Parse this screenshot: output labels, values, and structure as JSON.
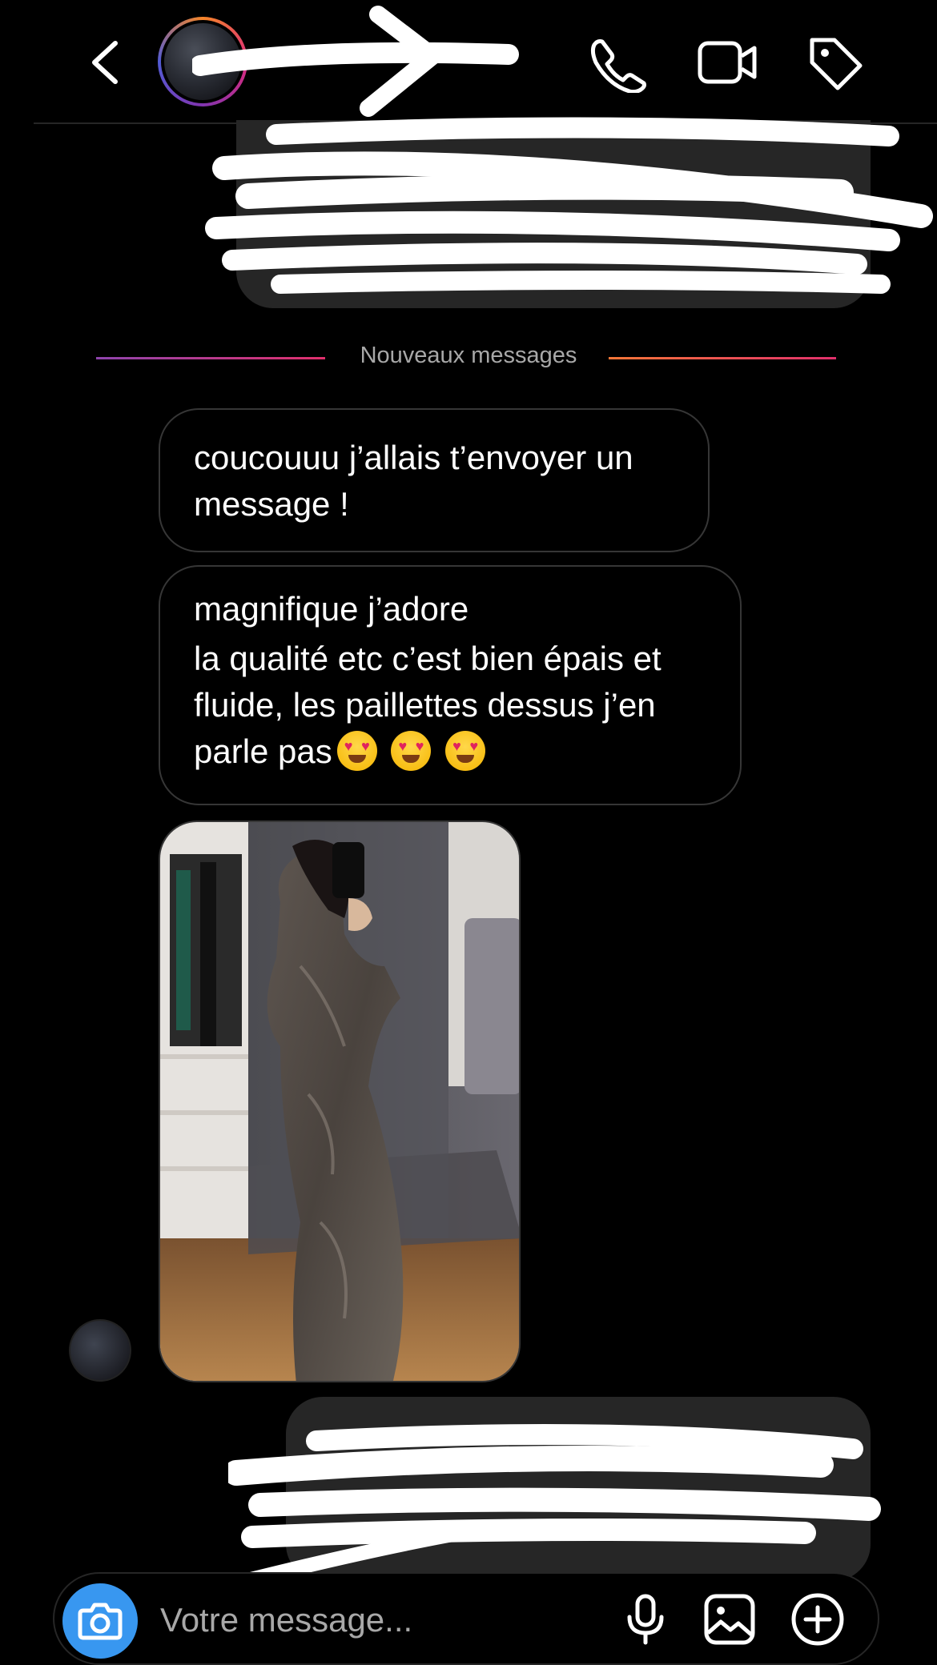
{
  "separator": {
    "label": "Nouveaux messages"
  },
  "messages": [
    {
      "sender": "them",
      "text": "coucouuu j’allais t’envoyer un message !"
    },
    {
      "sender": "them",
      "first_line": "magnifique j’adore",
      "body": "la qualité etc c’est bien épais et fluide, les paillettes dessus j’en parle pas"
    }
  ],
  "composer": {
    "placeholder": "Votre message..."
  },
  "icons": {
    "back": "chevron-left-icon",
    "call": "phone-icon",
    "video": "video-camera-icon",
    "tag": "tag-icon",
    "camera": "camera-icon",
    "mic": "microphone-icon",
    "gallery": "image-icon",
    "add": "plus-circle-icon"
  },
  "colors": {
    "background": "#000000",
    "bubble_sent": "#262626",
    "bubble_border": "#363636",
    "camera_button": "#3897f0",
    "separator_left": "#8e44ad",
    "separator_right": "#e1306c"
  }
}
